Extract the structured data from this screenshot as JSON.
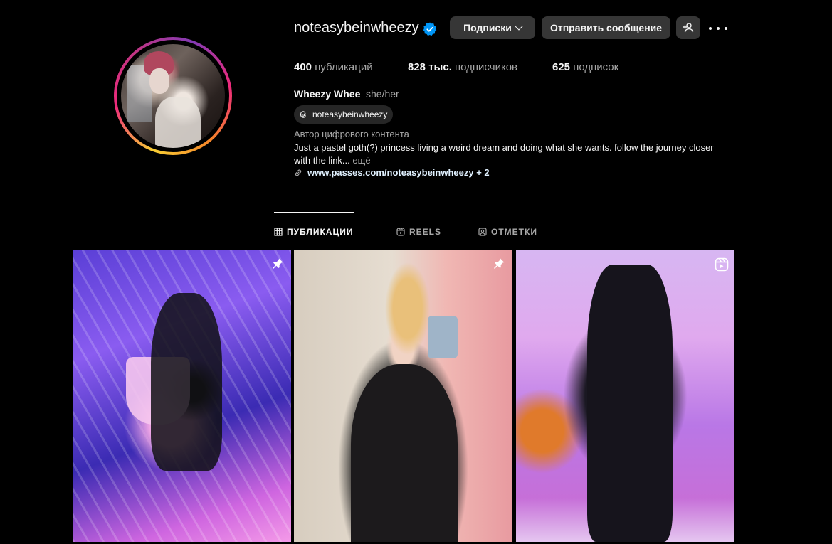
{
  "profile": {
    "username": "noteasybeinwheezy",
    "verified_icon": "verified-badge-icon",
    "following_label": "Подписки",
    "message_label": "Отправить сообщение",
    "stats": {
      "posts_count": "400",
      "posts_label": "публикаций",
      "followers_count": "828 тыс.",
      "followers_label": "подписчиков",
      "following_count": "625",
      "following_label": "подписок"
    },
    "full_name": "Wheezy Whee",
    "pronouns": "she/her",
    "threads_handle": "noteasybeinwheezy",
    "category": "Автор цифрового контента",
    "bio": "Just a pastel goth(?) princess living a weird dream and doing what she wants. follow the journey closer with the link...",
    "bio_more": "ещё",
    "link": "www.passes.com/noteasybeinwheezy",
    "link_extra": " + 2"
  },
  "tabs": [
    {
      "label": "ПУБЛИКАЦИИ",
      "icon": "grid-icon",
      "active": true
    },
    {
      "label": "REELS",
      "icon": "reels-icon",
      "active": false
    },
    {
      "label": "ОТМЕТКИ",
      "icon": "tagged-icon",
      "active": false
    }
  ],
  "posts": [
    {
      "badge": "pin-icon"
    },
    {
      "badge": "pin-icon"
    },
    {
      "badge": "reel-icon"
    }
  ],
  "colors": {
    "background": "#000000",
    "button": "#363636",
    "verified": "#0095f6",
    "secondary_text": "#a8a8a8",
    "link": "#e0f1ff"
  }
}
